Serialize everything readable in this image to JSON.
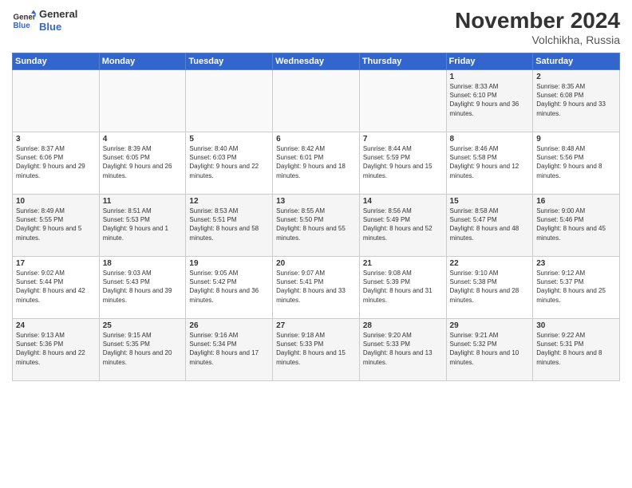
{
  "logo": {
    "line1": "General",
    "line2": "Blue"
  },
  "title": "November 2024",
  "location": "Volchikha, Russia",
  "weekdays": [
    "Sunday",
    "Monday",
    "Tuesday",
    "Wednesday",
    "Thursday",
    "Friday",
    "Saturday"
  ],
  "weeks": [
    [
      {
        "day": "",
        "info": ""
      },
      {
        "day": "",
        "info": ""
      },
      {
        "day": "",
        "info": ""
      },
      {
        "day": "",
        "info": ""
      },
      {
        "day": "",
        "info": ""
      },
      {
        "day": "1",
        "info": "Sunrise: 8:33 AM\nSunset: 6:10 PM\nDaylight: 9 hours and 36 minutes."
      },
      {
        "day": "2",
        "info": "Sunrise: 8:35 AM\nSunset: 6:08 PM\nDaylight: 9 hours and 33 minutes."
      }
    ],
    [
      {
        "day": "3",
        "info": "Sunrise: 8:37 AM\nSunset: 6:06 PM\nDaylight: 9 hours and 29 minutes."
      },
      {
        "day": "4",
        "info": "Sunrise: 8:39 AM\nSunset: 6:05 PM\nDaylight: 9 hours and 26 minutes."
      },
      {
        "day": "5",
        "info": "Sunrise: 8:40 AM\nSunset: 6:03 PM\nDaylight: 9 hours and 22 minutes."
      },
      {
        "day": "6",
        "info": "Sunrise: 8:42 AM\nSunset: 6:01 PM\nDaylight: 9 hours and 18 minutes."
      },
      {
        "day": "7",
        "info": "Sunrise: 8:44 AM\nSunset: 5:59 PM\nDaylight: 9 hours and 15 minutes."
      },
      {
        "day": "8",
        "info": "Sunrise: 8:46 AM\nSunset: 5:58 PM\nDaylight: 9 hours and 12 minutes."
      },
      {
        "day": "9",
        "info": "Sunrise: 8:48 AM\nSunset: 5:56 PM\nDaylight: 9 hours and 8 minutes."
      }
    ],
    [
      {
        "day": "10",
        "info": "Sunrise: 8:49 AM\nSunset: 5:55 PM\nDaylight: 9 hours and 5 minutes."
      },
      {
        "day": "11",
        "info": "Sunrise: 8:51 AM\nSunset: 5:53 PM\nDaylight: 9 hours and 1 minute."
      },
      {
        "day": "12",
        "info": "Sunrise: 8:53 AM\nSunset: 5:51 PM\nDaylight: 8 hours and 58 minutes."
      },
      {
        "day": "13",
        "info": "Sunrise: 8:55 AM\nSunset: 5:50 PM\nDaylight: 8 hours and 55 minutes."
      },
      {
        "day": "14",
        "info": "Sunrise: 8:56 AM\nSunset: 5:49 PM\nDaylight: 8 hours and 52 minutes."
      },
      {
        "day": "15",
        "info": "Sunrise: 8:58 AM\nSunset: 5:47 PM\nDaylight: 8 hours and 48 minutes."
      },
      {
        "day": "16",
        "info": "Sunrise: 9:00 AM\nSunset: 5:46 PM\nDaylight: 8 hours and 45 minutes."
      }
    ],
    [
      {
        "day": "17",
        "info": "Sunrise: 9:02 AM\nSunset: 5:44 PM\nDaylight: 8 hours and 42 minutes."
      },
      {
        "day": "18",
        "info": "Sunrise: 9:03 AM\nSunset: 5:43 PM\nDaylight: 8 hours and 39 minutes."
      },
      {
        "day": "19",
        "info": "Sunrise: 9:05 AM\nSunset: 5:42 PM\nDaylight: 8 hours and 36 minutes."
      },
      {
        "day": "20",
        "info": "Sunrise: 9:07 AM\nSunset: 5:41 PM\nDaylight: 8 hours and 33 minutes."
      },
      {
        "day": "21",
        "info": "Sunrise: 9:08 AM\nSunset: 5:39 PM\nDaylight: 8 hours and 31 minutes."
      },
      {
        "day": "22",
        "info": "Sunrise: 9:10 AM\nSunset: 5:38 PM\nDaylight: 8 hours and 28 minutes."
      },
      {
        "day": "23",
        "info": "Sunrise: 9:12 AM\nSunset: 5:37 PM\nDaylight: 8 hours and 25 minutes."
      }
    ],
    [
      {
        "day": "24",
        "info": "Sunrise: 9:13 AM\nSunset: 5:36 PM\nDaylight: 8 hours and 22 minutes."
      },
      {
        "day": "25",
        "info": "Sunrise: 9:15 AM\nSunset: 5:35 PM\nDaylight: 8 hours and 20 minutes."
      },
      {
        "day": "26",
        "info": "Sunrise: 9:16 AM\nSunset: 5:34 PM\nDaylight: 8 hours and 17 minutes."
      },
      {
        "day": "27",
        "info": "Sunrise: 9:18 AM\nSunset: 5:33 PM\nDaylight: 8 hours and 15 minutes."
      },
      {
        "day": "28",
        "info": "Sunrise: 9:20 AM\nSunset: 5:33 PM\nDaylight: 8 hours and 13 minutes."
      },
      {
        "day": "29",
        "info": "Sunrise: 9:21 AM\nSunset: 5:32 PM\nDaylight: 8 hours and 10 minutes."
      },
      {
        "day": "30",
        "info": "Sunrise: 9:22 AM\nSunset: 5:31 PM\nDaylight: 8 hours and 8 minutes."
      }
    ]
  ]
}
